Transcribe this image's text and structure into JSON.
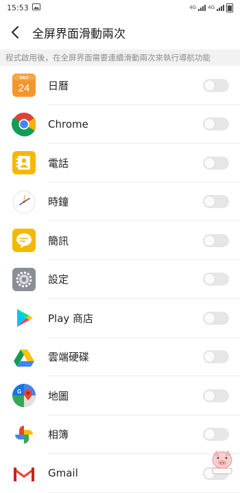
{
  "status_bar": {
    "time": "15:53",
    "net_label_1": "4G",
    "net_label_2": "4G"
  },
  "header": {
    "title": "全屏界面滑動兩次"
  },
  "description": "程式啟用後，在全屏界面需要連續滑動兩次來執行導航功能",
  "apps": [
    {
      "label": "日曆",
      "icon": "calendar-icon",
      "calendar_day": "24",
      "calendar_weekday": "WED",
      "enabled": false
    },
    {
      "label": "Chrome",
      "icon": "chrome-icon",
      "enabled": false
    },
    {
      "label": "電話",
      "icon": "phone-icon",
      "enabled": false
    },
    {
      "label": "時鐘",
      "icon": "clock-icon",
      "enabled": false
    },
    {
      "label": "簡訊",
      "icon": "messages-icon",
      "enabled": false
    },
    {
      "label": "設定",
      "icon": "settings-icon",
      "enabled": false
    },
    {
      "label": "Play 商店",
      "icon": "play-store-icon",
      "enabled": false
    },
    {
      "label": "雲端硬碟",
      "icon": "drive-icon",
      "enabled": false
    },
    {
      "label": "地圖",
      "icon": "maps-icon",
      "enabled": false
    },
    {
      "label": "相簿",
      "icon": "photos-icon",
      "enabled": false
    },
    {
      "label": "Gmail",
      "icon": "gmail-icon",
      "enabled": false
    }
  ],
  "colors": {
    "toggle_off": "#e6e6e6",
    "description_bg": "#f2f2f2",
    "calendar_orange": "#f5962b",
    "phone_yellow": "#f5b800"
  }
}
